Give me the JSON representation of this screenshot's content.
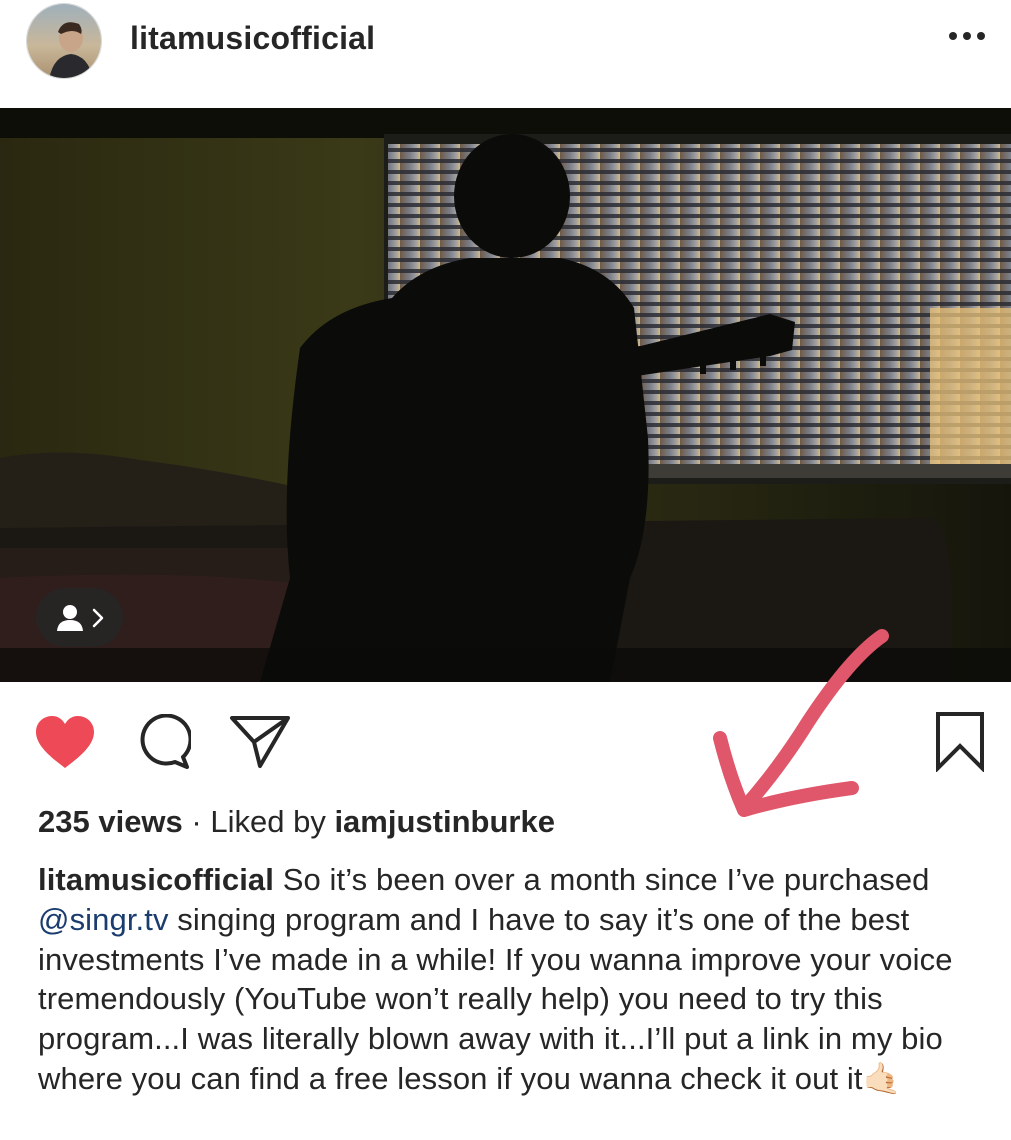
{
  "post": {
    "username": "litamusicofficial",
    "more_label": "•••",
    "views": "235 views",
    "separator": " · ",
    "liked_by_prefix": "Liked by ",
    "liked_by_user": "iamjustinburke",
    "caption": {
      "user": "litamusicofficial",
      "part1": " So it’s been over a month since I’ve purchased ",
      "mention": "@singr.tv",
      "part2": " singing program and I have to say it’s one of the best investments I’ve made in a while!  If you wanna improve your voice tremendously (YouTube won’t really help) you need to try this program...I was literally blown away with it...I’ll put a link in my bio where you can find a free lesson if you wanna check it out it",
      "emoji": "🤙🏻"
    }
  },
  "icons": {
    "like": "heart-icon",
    "comment": "comment-icon",
    "share": "paper-plane-icon",
    "save": "bookmark-icon",
    "tag": "user-tag-icon",
    "more": "more-options-icon"
  },
  "colors": {
    "like_red": "#ed4956",
    "mention_blue": "#1b3d6e",
    "annotation_arrow": "#e0566a",
    "text": "#262626"
  }
}
